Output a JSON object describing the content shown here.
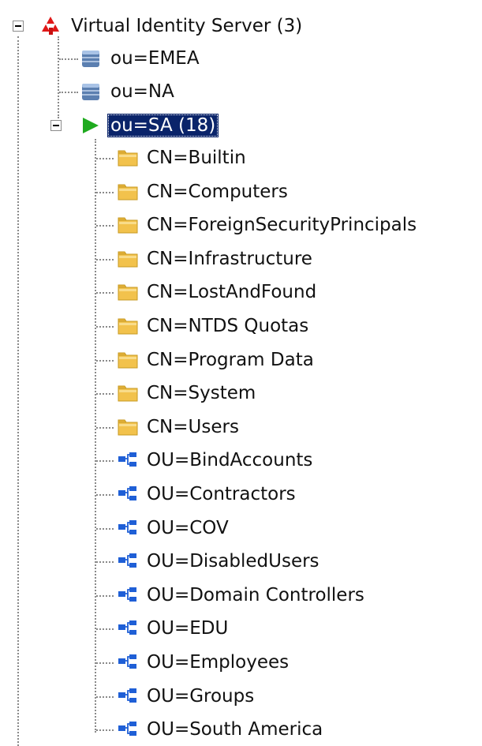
{
  "tree": {
    "root": {
      "label": "Virtual Identity Server (3)",
      "icon": "server-root-icon"
    },
    "partitions": [
      {
        "label": "ou=EMEA",
        "icon": "database-icon"
      },
      {
        "label": "ou=NA",
        "icon": "database-icon"
      },
      {
        "label": "ou=SA (18)",
        "icon": "play-arrow-icon",
        "selected": true
      }
    ],
    "children": [
      {
        "label": "CN=Builtin",
        "icon": "folder-icon"
      },
      {
        "label": "CN=Computers",
        "icon": "folder-icon"
      },
      {
        "label": "CN=ForeignSecurityPrincipals",
        "icon": "folder-icon"
      },
      {
        "label": "CN=Infrastructure",
        "icon": "folder-icon"
      },
      {
        "label": "CN=LostAndFound",
        "icon": "folder-icon"
      },
      {
        "label": "CN=NTDS Quotas",
        "icon": "folder-icon"
      },
      {
        "label": "CN=Program Data",
        "icon": "folder-icon"
      },
      {
        "label": "CN=System",
        "icon": "folder-icon"
      },
      {
        "label": "CN=Users",
        "icon": "folder-icon"
      },
      {
        "label": "OU=BindAccounts",
        "icon": "org-unit-icon"
      },
      {
        "label": "OU=Contractors",
        "icon": "org-unit-icon"
      },
      {
        "label": "OU=COV",
        "icon": "org-unit-icon"
      },
      {
        "label": "OU=DisabledUsers",
        "icon": "org-unit-icon"
      },
      {
        "label": "OU=Domain Controllers",
        "icon": "org-unit-icon"
      },
      {
        "label": "OU=EDU",
        "icon": "org-unit-icon"
      },
      {
        "label": "OU=Employees",
        "icon": "org-unit-icon"
      },
      {
        "label": "OU=Groups",
        "icon": "org-unit-icon"
      },
      {
        "label": "OU=South America",
        "icon": "org-unit-icon"
      }
    ]
  },
  "colors": {
    "selection_bg": "#0a246a",
    "selection_text": "#ffffff",
    "folder": "#f2c24c",
    "org_unit": "#1f5fd6",
    "database": "#5b7fb0",
    "play": "#1faa1f",
    "root": "#e01818"
  }
}
